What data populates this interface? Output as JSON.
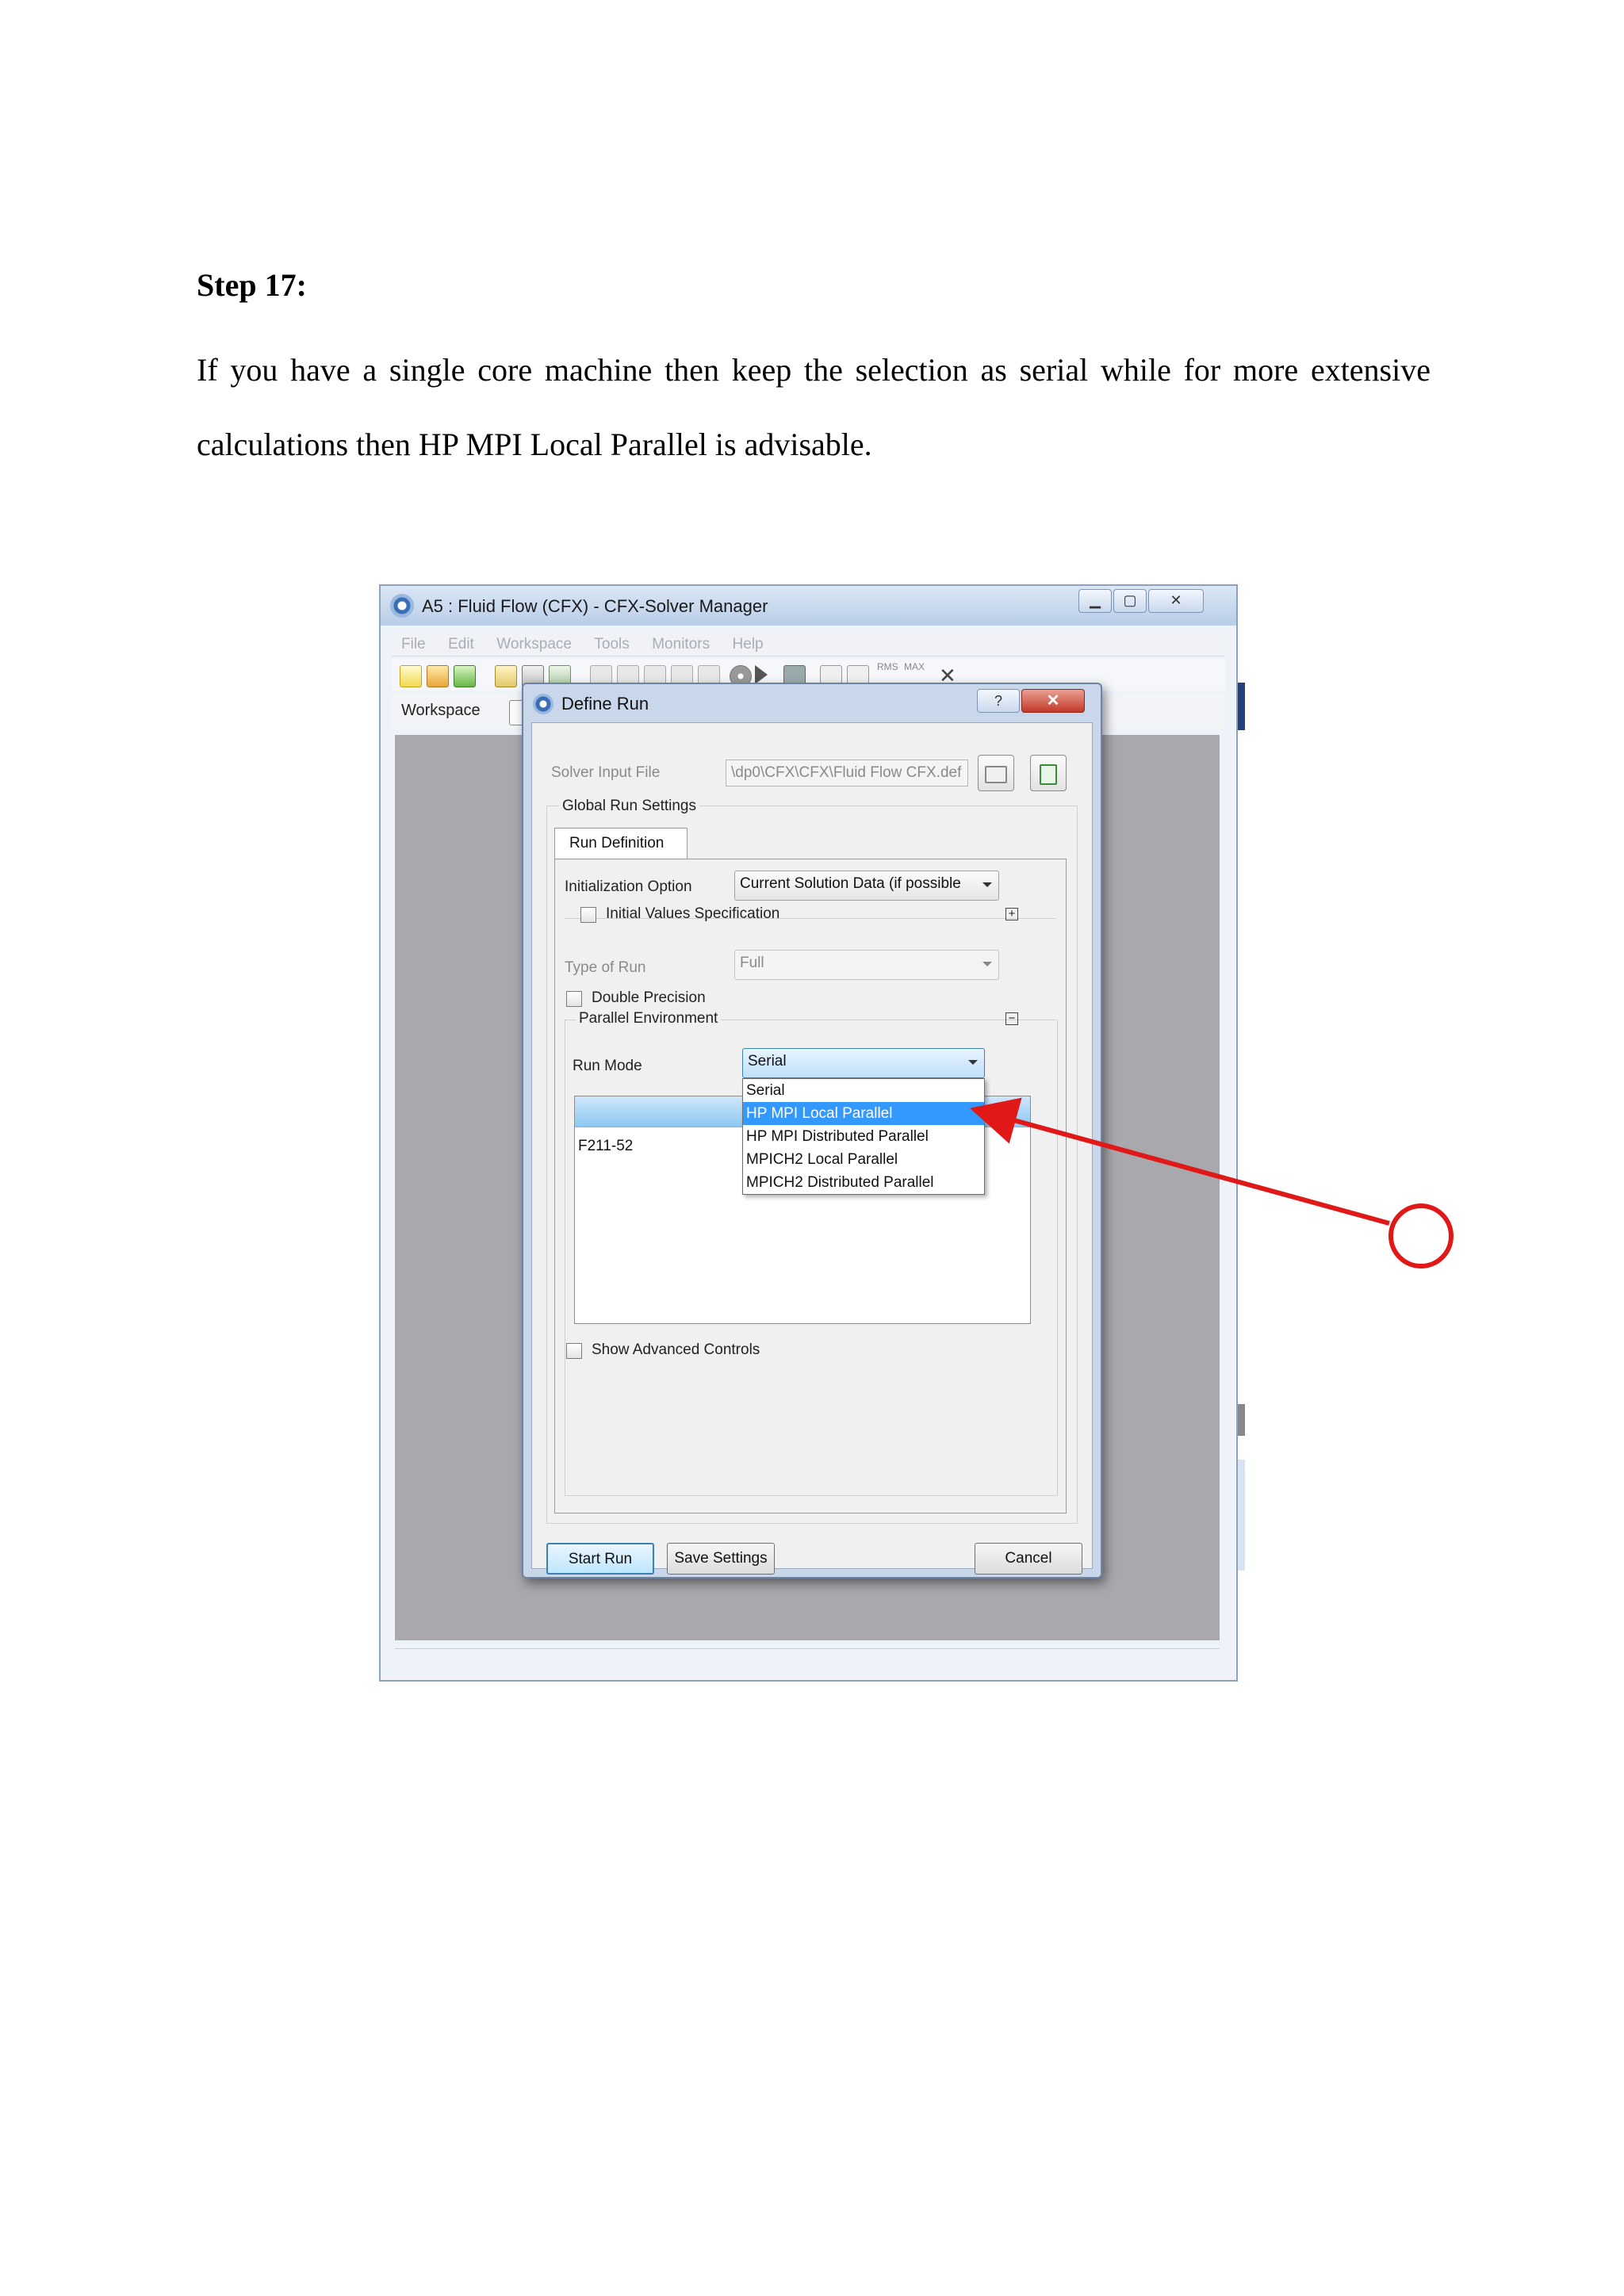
{
  "document": {
    "heading": "Step 17:",
    "paragraph": "If you have a single core machine then keep the selection as serial while for more extensive calculations then HP MPI Local Parallel is advisable."
  },
  "window": {
    "title": "A5 : Fluid Flow (CFX) - CFX-Solver Manager",
    "controls": {
      "minimize": "▁",
      "maximize": "▢",
      "close": "✕"
    },
    "menu": [
      "File",
      "Edit",
      "Workspace",
      "Tools",
      "Monitors",
      "Help"
    ],
    "toolbar_text": {
      "rms": "RMS",
      "max": "MAX",
      "close": "✕"
    },
    "workspace_tab": "Workspace"
  },
  "dialog": {
    "title": "Define Run",
    "help": "?",
    "close": "✕",
    "solver_input_label": "Solver Input File",
    "solver_input_value": "\\dp0\\CFX\\CFX\\Fluid Flow CFX.def",
    "global_settings_label": "Global Run Settings",
    "tab_label": "Run Definition",
    "init_option_label": "Initialization Option",
    "init_option_value": "Current Solution Data (if possible",
    "initial_values_label": "Initial Values Specification",
    "type_of_run_label": "Type of Run",
    "type_of_run_value": "Full",
    "double_precision_label": "Double Precision",
    "parallel_env_label": "Parallel Environment",
    "run_mode_label": "Run Mode",
    "run_mode_value": "Serial",
    "run_mode_options": [
      "Serial",
      "HP MPI Local Parallel",
      "HP MPI Distributed Parallel",
      "MPICH2 Local Parallel",
      "MPICH2 Distributed Parallel"
    ],
    "run_mode_selected_index": 1,
    "host_name": "F211-52",
    "show_advanced_label": "Show Advanced Controls",
    "start_run": "Start Run",
    "save_settings": "Save Settings",
    "cancel": "Cancel"
  },
  "colors": {
    "annotation": "#e01818",
    "selection": "#3399ff"
  }
}
